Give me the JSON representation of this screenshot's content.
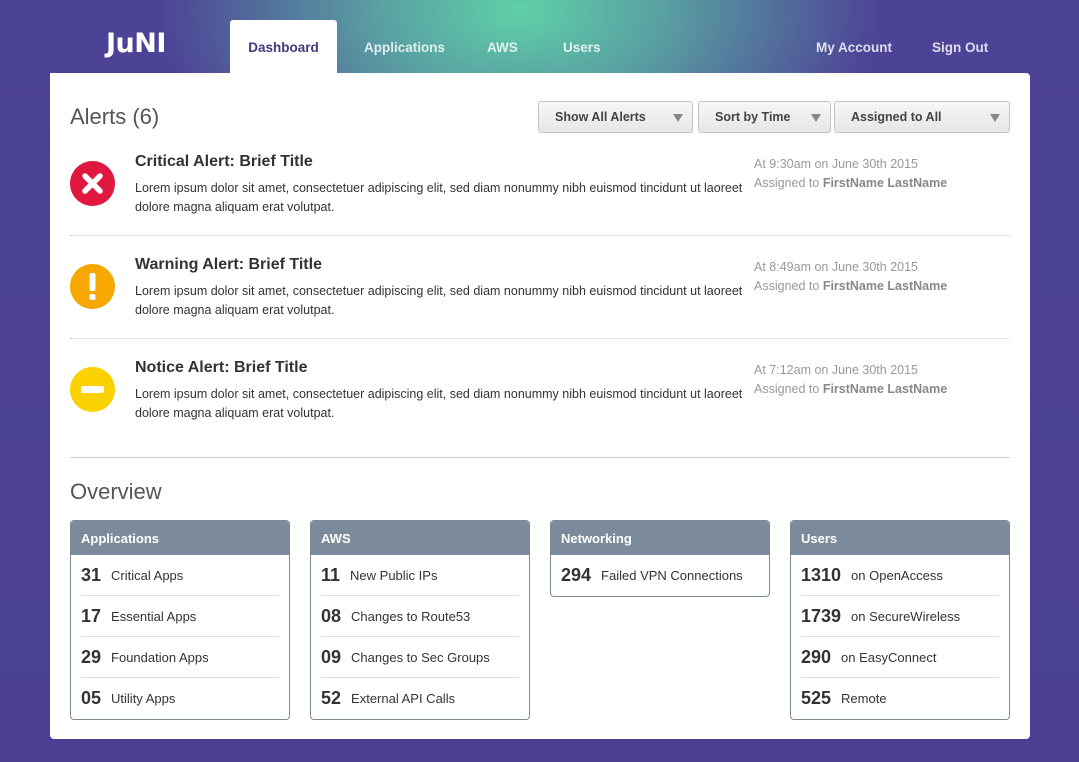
{
  "brand": {
    "logo": "JuNI"
  },
  "nav": {
    "tabs": [
      {
        "label": "Dashboard",
        "active": true
      },
      {
        "label": "Applications"
      },
      {
        "label": "AWS"
      },
      {
        "label": "Users"
      }
    ],
    "right": [
      {
        "label": "My Account"
      },
      {
        "label": "Sign Out"
      }
    ]
  },
  "alerts": {
    "title": "Alerts (6)",
    "filters": {
      "show": "Show All Alerts",
      "sort": "Sort by Time",
      "assigned": "Assigned to All"
    },
    "items": [
      {
        "level": "critical",
        "icon": "x-circle-icon",
        "title": "Critical Alert: Brief Title",
        "body": "Lorem ipsum dolor sit amet, consectetuer adipiscing elit, sed diam nonummy nibh euismod tincidunt ut laoreet dolore magna aliquam erat volutpat.",
        "time": "At 9:30am on June 30th 2015",
        "assigned_prefix": "Assigned to",
        "assignee": "FirstName LastName"
      },
      {
        "level": "warning",
        "icon": "exclamation-circle-icon",
        "title": "Warning Alert: Brief Title",
        "body": "Lorem ipsum dolor sit amet, consectetuer adipiscing elit, sed diam nonummy nibh euismod tincidunt ut laoreet dolore magna aliquam erat volutpat.",
        "time": "At 8:49am on June 30th 2015",
        "assigned_prefix": "Assigned to",
        "assignee": "FirstName LastName"
      },
      {
        "level": "notice",
        "icon": "minus-circle-icon",
        "title": "Notice Alert: Brief Title",
        "body": "Lorem ipsum dolor sit amet, consectetuer adipiscing elit, sed diam nonummy nibh euismod tincidunt ut laoreet dolore magna aliquam erat volutpat.",
        "time": "At 7:12am on June 30th 2015",
        "assigned_prefix": "Assigned to",
        "assignee": "FirstName LastName"
      }
    ]
  },
  "overview": {
    "title": "Overview",
    "cards": [
      {
        "header": "Applications",
        "rows": [
          {
            "num": "31",
            "label": "Critical Apps"
          },
          {
            "num": "17",
            "label": "Essential Apps"
          },
          {
            "num": "29",
            "label": "Foundation Apps"
          },
          {
            "num": "05",
            "label": "Utility Apps"
          }
        ]
      },
      {
        "header": "AWS",
        "rows": [
          {
            "num": "11",
            "label": "New Public IPs"
          },
          {
            "num": "08",
            "label": "Changes to Route53"
          },
          {
            "num": "09",
            "label": "Changes to Sec Groups"
          },
          {
            "num": "52",
            "label": "External API Calls"
          }
        ]
      },
      {
        "header": "Networking",
        "rows": [
          {
            "num": "294",
            "label": "Failed VPN Connections"
          }
        ]
      },
      {
        "header": "Users",
        "rows": [
          {
            "num": "1310",
            "label": "on OpenAccess"
          },
          {
            "num": "1739",
            "label": "on SecureWireless"
          },
          {
            "num": "290",
            "label": "on EasyConnect"
          },
          {
            "num": "525",
            "label": "Remote"
          }
        ]
      }
    ]
  },
  "colors": {
    "background": "#4b3f95",
    "glow": "#5fd0a8",
    "critical": "#e0173f",
    "warning": "#f6a700",
    "notice": "#fbd100",
    "card_header": "#7b8b9b"
  }
}
